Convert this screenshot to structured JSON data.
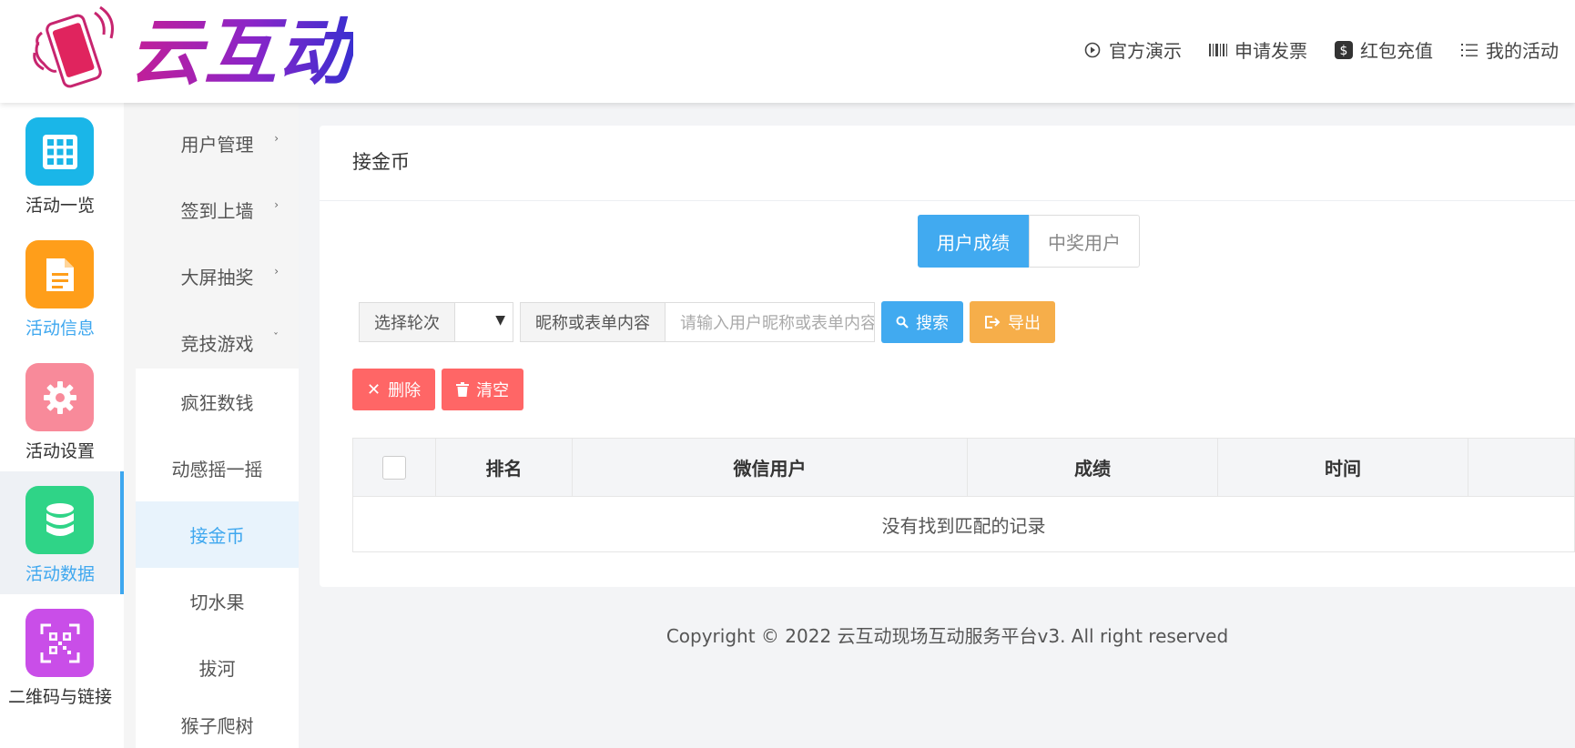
{
  "brand": {
    "logo_text": "云互动"
  },
  "topnav": [
    {
      "icon": "play-circle-icon",
      "label": "官方演示"
    },
    {
      "icon": "barcode-icon",
      "label": "申请发票"
    },
    {
      "icon": "dollar-icon",
      "label": "红包充值"
    },
    {
      "icon": "list-icon",
      "label": "我的活动"
    }
  ],
  "iconbar": [
    {
      "label": "活动一览",
      "icon": "grid-icon",
      "color": "#1ab6e8"
    },
    {
      "label": "活动信息",
      "icon": "document-icon",
      "color": "#ff9e1a"
    },
    {
      "label": "活动设置",
      "icon": "gear-icon",
      "color": "#f88a9a"
    },
    {
      "label": "活动数据",
      "icon": "database-icon",
      "color": "#2fd487"
    },
    {
      "label": "二维码与链接",
      "icon": "qrcode-icon",
      "color": "#c94ee8"
    }
  ],
  "submenu": {
    "groups": [
      "用户管理",
      "签到上墙",
      "大屏抽奖",
      "竞技游戏"
    ],
    "items": [
      "疯狂数钱",
      "动感摇一摇",
      "接金币",
      "切水果",
      "拔河",
      "猴子爬树"
    ]
  },
  "panel": {
    "title": "接金币",
    "tabs": [
      "用户成绩",
      "中奖用户"
    ],
    "filters": {
      "round_label": "选择轮次",
      "keyword_label": "昵称或表单内容",
      "keyword_placeholder": "请输入用户昵称或表单内容",
      "search_label": "搜索",
      "export_label": "导出"
    },
    "actions": {
      "delete_label": "删除",
      "clear_label": "清空"
    },
    "table": {
      "columns": [
        "排名",
        "微信用户",
        "成绩",
        "时间",
        ""
      ],
      "empty_text": "没有找到匹配的记录"
    }
  },
  "footer": {
    "text": "Copyright © 2022 云互动现场互动服务平台v3. All right reserved"
  }
}
